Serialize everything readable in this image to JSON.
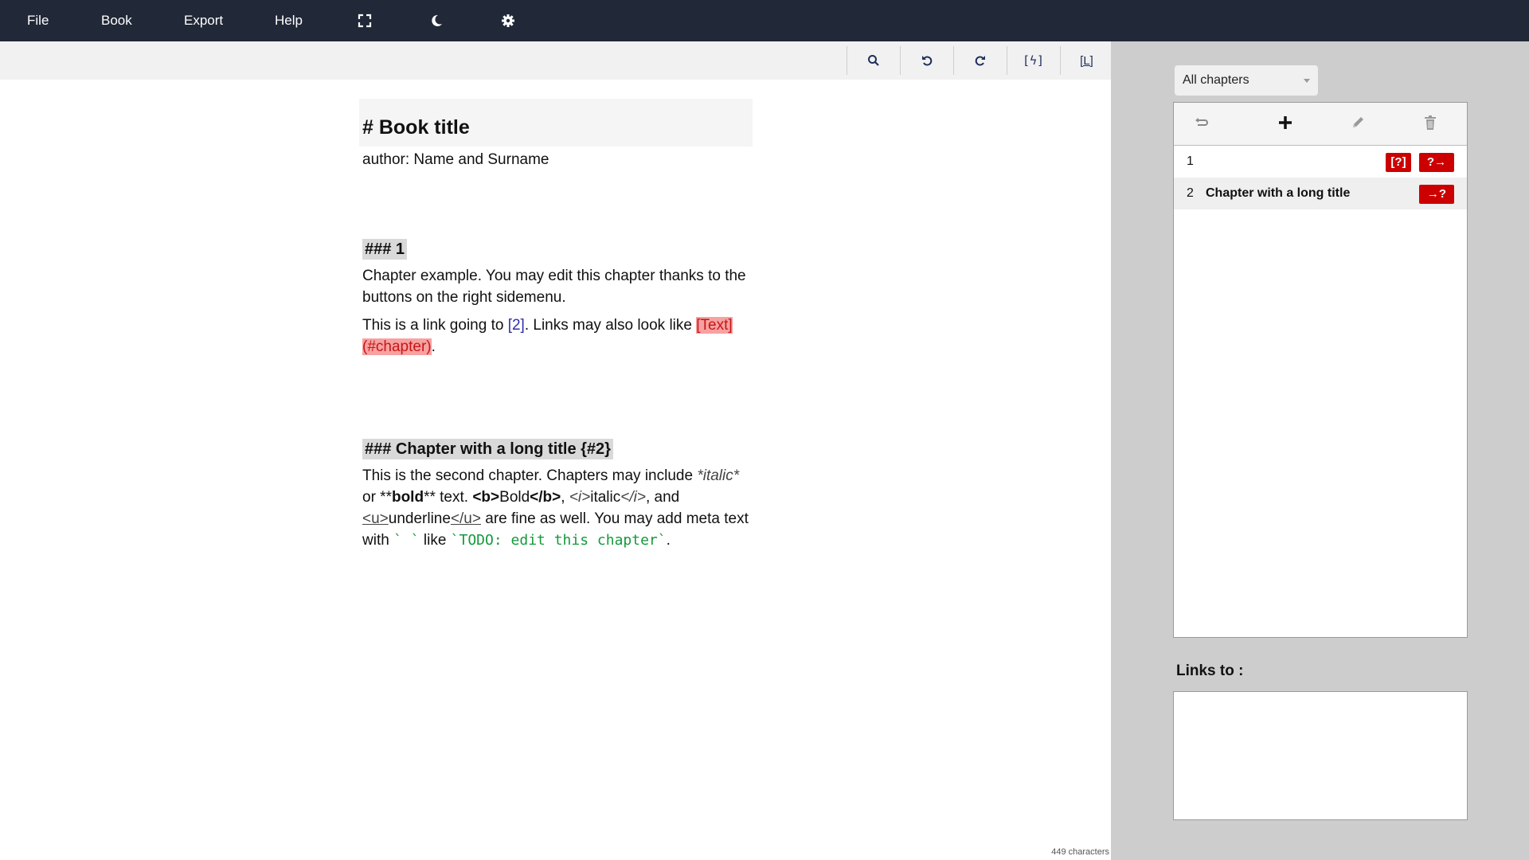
{
  "menubar": {
    "items": [
      "File",
      "Book",
      "Export",
      "Help"
    ],
    "icons": [
      "fullscreen-icon",
      "moon-icon",
      "gear-icon"
    ]
  },
  "toolbar": {
    "buttons": [
      "search-icon",
      "undo-icon",
      "redo-icon",
      "lightning-link-icon",
      "link-icon"
    ],
    "lightning_label": "[ϟ]",
    "link_label": "[L]"
  },
  "editor": {
    "title": "# Book title",
    "author": "author: Name and Surname",
    "chapter1": {
      "heading": "### 1",
      "para1": "Chapter example. You may edit this chapter thanks to the buttons on the right sidemenu.",
      "para2_prefix": "This is a link going to ",
      "para2_link": "[2]",
      "para2_middle": ". Links may also look like ",
      "para2_badlink": "[Text](#chapter)",
      "para2_suffix": "."
    },
    "chapter2": {
      "heading": "### Chapter with a long title {#2}",
      "t1": "This is the second chapter. Chapters may include ",
      "italic_md": "*italic*",
      "t2": " or **",
      "bold_md": "bold",
      "t3": "** text. ",
      "b_open": "<b>",
      "b_text": "Bold",
      "b_close": "</b>",
      "t4": ", ",
      "i_open": "<i>",
      "i_text": "italic",
      "i_close": "</i>",
      "t5": ", and ",
      "u_open": "<u>",
      "u_text": "underline",
      "u_close": "</u>",
      "t6": " are fine as well. You may add meta text with ",
      "meta_empty": "` `",
      "t7": " like ",
      "meta_example": "`TODO: edit this chapter`",
      "t8": "."
    },
    "char_count": "449 characters"
  },
  "sidebar": {
    "filter": "All chapters",
    "chapter_tools": [
      "return-icon",
      "plus-icon",
      "pencil-icon",
      "trash-icon"
    ],
    "chapters": [
      {
        "num": "1",
        "title": "",
        "badges": [
          "[?]",
          "?→"
        ]
      },
      {
        "num": "2",
        "title": "Chapter with a long title",
        "badges": [
          "→?"
        ]
      }
    ],
    "links_to_label": "Links to :"
  },
  "colors": {
    "menubar": "#212838",
    "sidebar": "#cdcdcd",
    "badge": "#cc0000",
    "link": "#2d2fae",
    "meta": "#149a3c"
  }
}
